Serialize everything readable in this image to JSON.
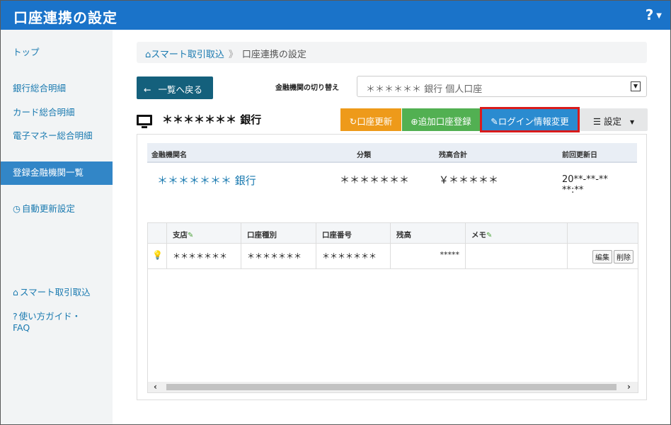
{
  "header": {
    "title": "口座連携の設定",
    "help": "?"
  },
  "sidebar": {
    "items": [
      {
        "label": "トップ"
      },
      {
        "label": "銀行総合明細"
      },
      {
        "label": "カード総合明細"
      },
      {
        "label": "電子マネー総合明細"
      },
      {
        "label": "登録金融機関一覧"
      },
      {
        "label": "自動更新設定"
      },
      {
        "label": "スマート取引取込"
      },
      {
        "label": "使い方ガイド・FAQ"
      }
    ]
  },
  "breadcrumb": {
    "home": "スマート取引取込",
    "current": "口座連携の設定"
  },
  "toolbar": {
    "back_label": "一覧へ戻る",
    "switch_label": "金融機関の切り替え",
    "switch_value": "＊＊＊＊＊＊ 銀行  個人口座"
  },
  "bank": {
    "name": "＊＊＊＊＊＊＊ 銀行"
  },
  "actions": {
    "refresh": "口座更新",
    "add": "追加口座登録",
    "login": "ログイン情報変更",
    "settings": "設定"
  },
  "summary": {
    "headers": [
      "金融機関名",
      "分類",
      "残高合計",
      "前回更新日"
    ],
    "row": {
      "name": "＊＊＊＊＊＊＊ 銀行",
      "category": "＊＊＊＊＊＊＊",
      "balance": "￥＊＊＊＊＊",
      "updated": "20**-**-** **:**"
    }
  },
  "accounts": {
    "headers": [
      "支店",
      "口座種別",
      "口座番号",
      "残高",
      "メモ"
    ],
    "rows": [
      {
        "branch": "＊＊＊＊＊＊＊",
        "type": "＊＊＊＊＊＊＊",
        "number": "＊＊＊＊＊＊＊",
        "balance": "*****",
        "memo": "",
        "edit": "編集",
        "delete": "削除"
      }
    ]
  }
}
